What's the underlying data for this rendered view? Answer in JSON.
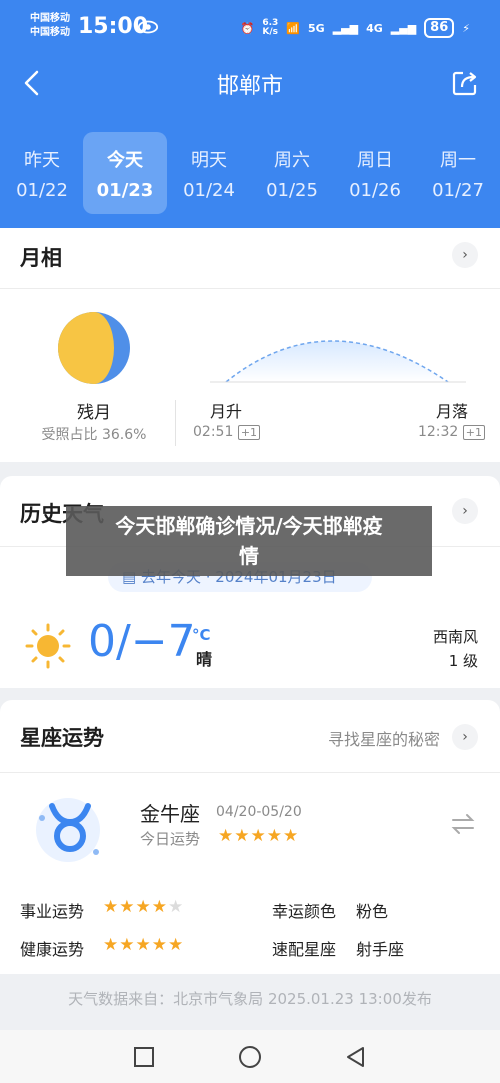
{
  "status": {
    "carrier1": "中国移动",
    "carrier2": "中国移动",
    "time": "15:00",
    "speed": "6.3\nK/s",
    "net1": "5G",
    "net2": "4G",
    "battery": "86"
  },
  "header": {
    "city": "邯郸市"
  },
  "tabs": [
    {
      "day": "昨天",
      "date": "01/22"
    },
    {
      "day": "今天",
      "date": "01/23"
    },
    {
      "day": "明天",
      "date": "01/24"
    },
    {
      "day": "周六",
      "date": "01/25"
    },
    {
      "day": "周日",
      "date": "01/26"
    },
    {
      "day": "周一",
      "date": "01/27"
    }
  ],
  "moon": {
    "title": "月相",
    "phase": "残月",
    "illum": "受照占比 36.6%",
    "rise_label": "月升",
    "rise_time": "02:51",
    "rise_tag": "+1",
    "set_label": "月落",
    "set_time": "12:32",
    "set_tag": "+1"
  },
  "history": {
    "title": "历史天气",
    "pill": "去年今天 · 2024年01月23日",
    "temp": "0/−7",
    "unit": "°C",
    "cond": "晴",
    "wind_dir": "西南风",
    "wind_lvl": "1 级"
  },
  "overlay": {
    "line1": "今天邯郸确诊情况/今天邯郸疫",
    "line2": "情"
  },
  "horoscope": {
    "title": "星座运势",
    "link": "寻找星座的秘密",
    "sign": "金牛座",
    "range": "04/20-05/20",
    "today": "今日运势",
    "today_stars": 5,
    "career_label": "事业运势",
    "career_stars": 4,
    "color_label": "幸运颜色",
    "color_value": "粉色",
    "health_label": "健康运势",
    "health_stars": 5,
    "match_label": "速配星座",
    "match_value": "射手座"
  },
  "footer": "天气数据来自：北京市气象局 2025.01.23 13:00发布",
  "colors": {
    "primary": "#3c86f0",
    "star": "#f6a623"
  }
}
